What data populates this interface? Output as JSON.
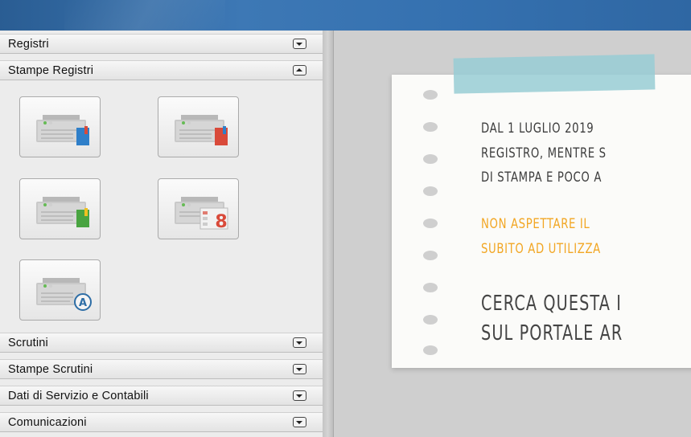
{
  "sidebar": {
    "sections": [
      {
        "label": "Registri",
        "state": "collapsed"
      },
      {
        "label": "Stampe Registri",
        "state": "expanded"
      },
      {
        "label": "Scrutini",
        "state": "collapsed"
      },
      {
        "label": "Stampe Scrutini",
        "state": "collapsed"
      },
      {
        "label": "Dati di Servizio e Contabili",
        "state": "collapsed"
      },
      {
        "label": "Comunicazioni",
        "state": "collapsed"
      }
    ],
    "stampe_registri_icons": [
      {
        "icon": "printer-blue-book-icon",
        "accent": "#2f7fc9"
      },
      {
        "icon": "printer-red-book-icon",
        "accent": "#d94a3a"
      },
      {
        "icon": "printer-green-book-icon",
        "accent": "#49a441"
      },
      {
        "icon": "printer-calendar-8-icon",
        "badge": "8",
        "accent": "#d94a3a"
      },
      {
        "icon": "printer-letter-a-icon",
        "badge": "A",
        "accent": "#2e6ea6"
      }
    ]
  },
  "notice": {
    "lines_dark": [
      "DAL 1 LUGLIO 2019",
      "REGISTRO, MENTRE S",
      "DI STAMPA E POCO A"
    ],
    "lines_orange": [
      "NON ASPETTARE IL",
      "SUBITO AD UTILIZZA"
    ],
    "lines_big": [
      "CERCA QUESTA I",
      "SUL PORTALE AR"
    ]
  },
  "colors": {
    "titlebar": "#3571b0",
    "tape": "#98cdd5",
    "orange_text": "#f2a623"
  }
}
